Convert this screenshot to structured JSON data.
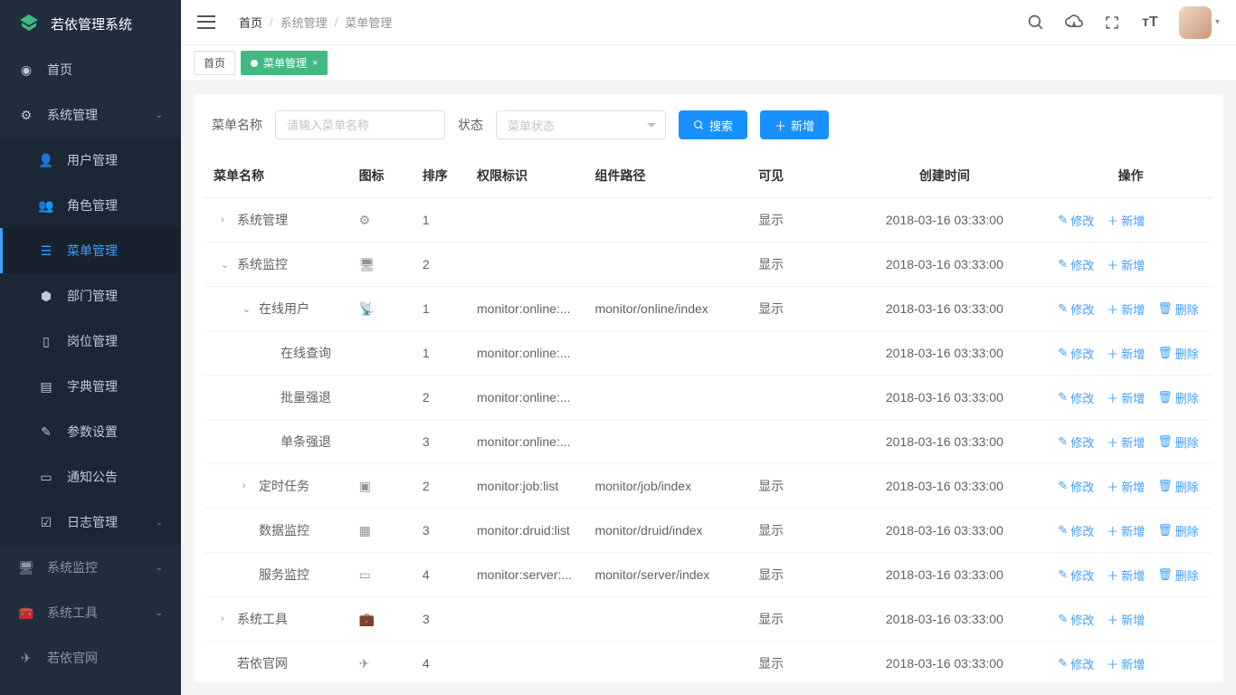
{
  "brand": "若依管理系统",
  "sidebar": {
    "home": "首页",
    "group_sys": "系统管理",
    "items": [
      "用户管理",
      "角色管理",
      "菜单管理",
      "部门管理",
      "岗位管理",
      "字典管理",
      "参数设置",
      "通知公告",
      "日志管理"
    ],
    "group_monitor": "系统监控",
    "group_tool": "系统工具",
    "group_site": "若依官网"
  },
  "breadcrumb": [
    "首页",
    "系统管理",
    "菜单管理"
  ],
  "tabs": {
    "home": "首页",
    "menu": "菜单管理"
  },
  "filter": {
    "label_name": "菜单名称",
    "ph_name": "请输入菜单名称",
    "label_state": "状态",
    "ph_state": "菜单状态",
    "btn_search": "搜索",
    "btn_add": "新增"
  },
  "thead": [
    "菜单名称",
    "图标",
    "排序",
    "权限标识",
    "组件路径",
    "可见",
    "创建时间",
    "操作"
  ],
  "ops": {
    "edit": "修改",
    "add": "新增",
    "del": "删除"
  },
  "rows": [
    {
      "exp": "r",
      "indent": 0,
      "name": "系统管理",
      "icon": "gear",
      "sort": 1,
      "perm": "",
      "comp": "",
      "vis": "显示",
      "time": "2018-03-16 03:33:00",
      "del": false
    },
    {
      "exp": "d",
      "indent": 0,
      "name": "系统监控",
      "icon": "monitor",
      "sort": 2,
      "perm": "",
      "comp": "",
      "vis": "显示",
      "time": "2018-03-16 03:33:00",
      "del": false
    },
    {
      "exp": "d",
      "indent": 1,
      "name": "在线用户",
      "icon": "broadcast",
      "sort": 1,
      "perm": "monitor:online:...",
      "comp": "monitor/online/index",
      "vis": "显示",
      "time": "2018-03-16 03:33:00",
      "del": true
    },
    {
      "exp": "",
      "indent": 2,
      "name": "在线查询",
      "icon": "",
      "sort": 1,
      "perm": "monitor:online:...",
      "comp": "",
      "vis": "",
      "time": "2018-03-16 03:33:00",
      "del": true
    },
    {
      "exp": "",
      "indent": 2,
      "name": "批量强退",
      "icon": "",
      "sort": 2,
      "perm": "monitor:online:...",
      "comp": "",
      "vis": "",
      "time": "2018-03-16 03:33:00",
      "del": true
    },
    {
      "exp": "",
      "indent": 2,
      "name": "单条强退",
      "icon": "",
      "sort": 3,
      "perm": "monitor:online:...",
      "comp": "",
      "vis": "",
      "time": "2018-03-16 03:33:00",
      "del": true
    },
    {
      "exp": "r",
      "indent": 1,
      "name": "定时任务",
      "icon": "clock",
      "sort": 2,
      "perm": "monitor:job:list",
      "comp": "monitor/job/index",
      "vis": "显示",
      "time": "2018-03-16 03:33:00",
      "del": true
    },
    {
      "exp": "",
      "indent": 1,
      "name": "数据监控",
      "icon": "db",
      "sort": 3,
      "perm": "monitor:druid:list",
      "comp": "monitor/druid/index",
      "vis": "显示",
      "time": "2018-03-16 03:33:00",
      "del": true
    },
    {
      "exp": "",
      "indent": 1,
      "name": "服务监控",
      "icon": "screen",
      "sort": 4,
      "perm": "monitor:server:...",
      "comp": "monitor/server/index",
      "vis": "显示",
      "time": "2018-03-16 03:33:00",
      "del": true
    },
    {
      "exp": "r",
      "indent": 0,
      "name": "系统工具",
      "icon": "suitcase",
      "sort": 3,
      "perm": "",
      "comp": "",
      "vis": "显示",
      "time": "2018-03-16 03:33:00",
      "del": false
    },
    {
      "exp": "",
      "indent": 0,
      "name": "若依官网",
      "icon": "plane",
      "sort": 4,
      "perm": "",
      "comp": "",
      "vis": "显示",
      "time": "2018-03-16 03:33:00",
      "del": false
    }
  ]
}
